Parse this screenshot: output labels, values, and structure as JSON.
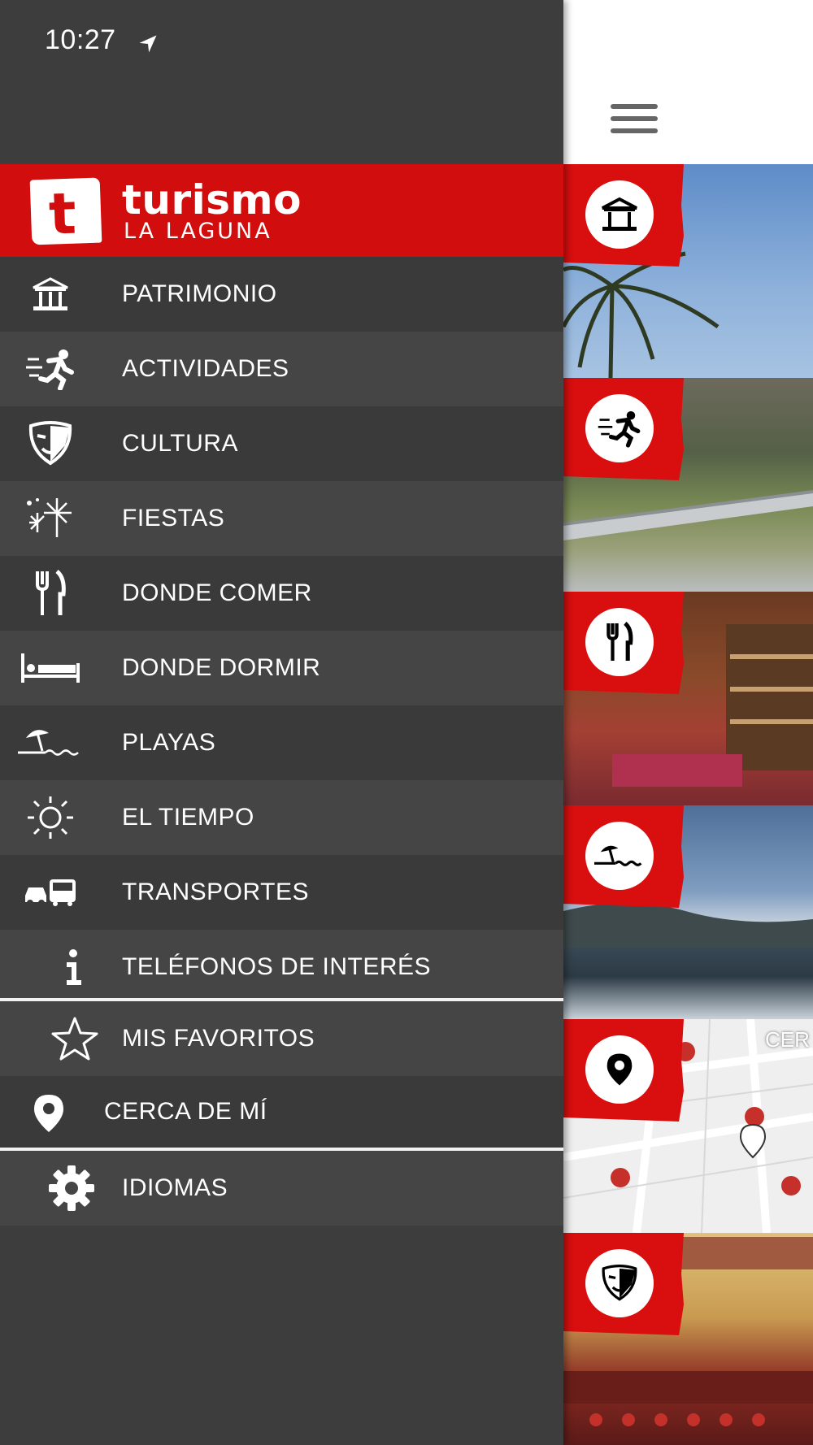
{
  "status": {
    "time": "10:27"
  },
  "brand": {
    "letter": "t",
    "title": "turismo",
    "subtitle": "LA LAGUNA"
  },
  "menu": [
    {
      "label": "PATRIMONIO",
      "icon": "building-icon"
    },
    {
      "label": "ACTIVIDADES",
      "icon": "runner-icon"
    },
    {
      "label": "CULTURA",
      "icon": "theater-mask-icon"
    },
    {
      "label": "FIESTAS",
      "icon": "fireworks-icon"
    },
    {
      "label": "DONDE COMER",
      "icon": "fork-knife-icon"
    },
    {
      "label": "DONDE DORMIR",
      "icon": "bed-icon"
    },
    {
      "label": "PLAYAS",
      "icon": "beach-umbrella-icon"
    },
    {
      "label": "EL TIEMPO",
      "icon": "sun-icon"
    },
    {
      "label": "TRANSPORTES",
      "icon": "car-bus-icon"
    },
    {
      "label": "TELÉFONOS DE INTERÉS",
      "icon": "info-icon"
    }
  ],
  "extras": [
    {
      "label": "MIS FAVORITOS",
      "icon": "star-icon"
    },
    {
      "label": "CERCA DE MÍ",
      "icon": "location-pin-icon"
    }
  ],
  "settings": {
    "label": "IDIOMAS",
    "icon": "gear-icon"
  },
  "content": {
    "tiles": [
      "building-icon",
      "runner-icon",
      "fork-knife-icon",
      "beach-umbrella-icon",
      "location-pin-icon",
      "theater-mask-icon"
    ],
    "map_label": "CER"
  },
  "colors": {
    "brand_red": "#d10d0d",
    "drawer_bg": "#3d3d3d"
  }
}
